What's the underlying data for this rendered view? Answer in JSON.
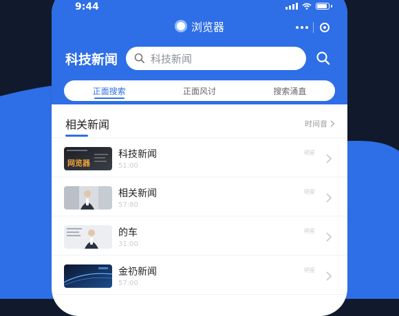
{
  "status_bar": {
    "time": "9:44"
  },
  "app": {
    "name": "浏览器"
  },
  "header": {
    "title": "科技新闻",
    "search_placeholder": "科技新闻"
  },
  "tabs": [
    {
      "label": "正面搜索",
      "active": true
    },
    {
      "label": "正面风讨",
      "active": false
    },
    {
      "label": "搜索涌直",
      "active": false
    }
  ],
  "section": {
    "title": "相关新闻",
    "more_label": "时间音"
  },
  "news": [
    {
      "title": "科技新闻",
      "time": "51:00",
      "tag": "明星",
      "thumb_text": "网览器"
    },
    {
      "title": "相关新闻",
      "time": "57:80",
      "tag": "明星"
    },
    {
      "title": "的车",
      "time": "31:00",
      "tag": "明星"
    },
    {
      "title": "金礽新闻",
      "time": "57:00",
      "tag": "明星"
    }
  ],
  "colors": {
    "accent": "#2e6ee6",
    "background": "#101a2c",
    "wave": "#2e6ee6"
  }
}
